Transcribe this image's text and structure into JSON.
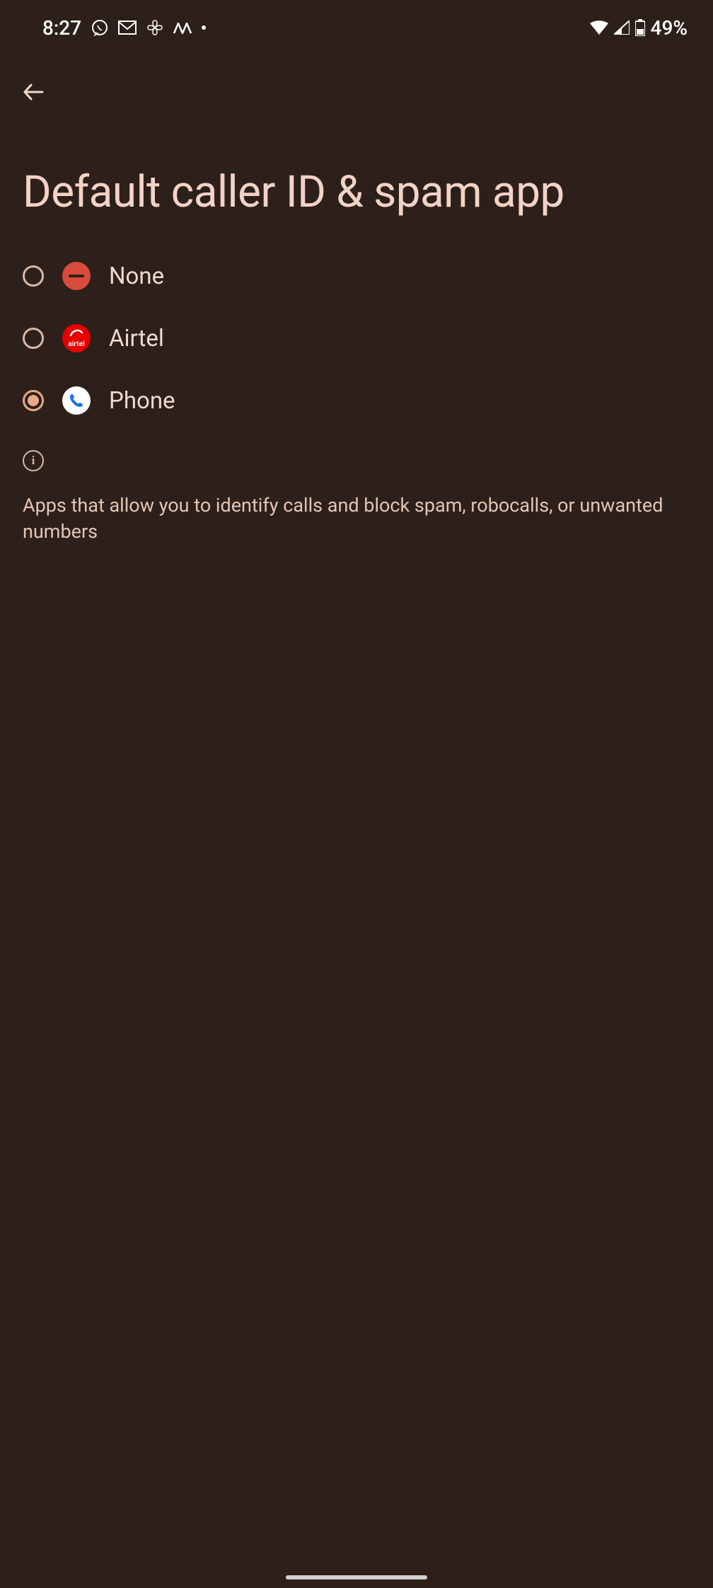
{
  "status": {
    "time": "8:27",
    "battery": "49%"
  },
  "title": "Default caller ID & spam app",
  "options": [
    {
      "label": "None",
      "selected": false
    },
    {
      "label": "Airtel",
      "selected": false
    },
    {
      "label": "Phone",
      "selected": true
    }
  ],
  "description": "Apps that allow you to identify calls and block spam, robocalls, or unwanted numbers"
}
